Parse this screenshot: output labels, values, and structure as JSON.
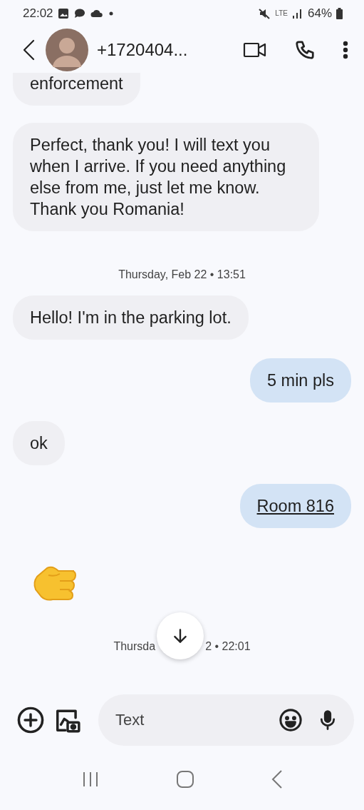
{
  "status_bar": {
    "time": "22:02",
    "network": "LTE",
    "battery": "64%"
  },
  "header": {
    "contact": "+1720404..."
  },
  "messages": [
    {
      "kind": "incoming",
      "text": "enforcement"
    },
    {
      "kind": "incoming",
      "text": "Perfect, thank you! I will text you when I arrive. If you need anything else from me, just let me know. Thank you Romania!"
    },
    {
      "kind": "date",
      "text": "Thursday, Feb 22 • 13:51"
    },
    {
      "kind": "incoming",
      "text": "Hello! I'm in the parking lot."
    },
    {
      "kind": "outgoing",
      "text": "5 min pls"
    },
    {
      "kind": "incoming",
      "text": "ok"
    },
    {
      "kind": "outgoing",
      "text": "Room 816",
      "link": true
    },
    {
      "kind": "emoji"
    },
    {
      "kind": "covered_date",
      "before": "Thursda",
      "after": "2 • 22:01"
    }
  ],
  "composer": {
    "placeholder": "Text"
  }
}
